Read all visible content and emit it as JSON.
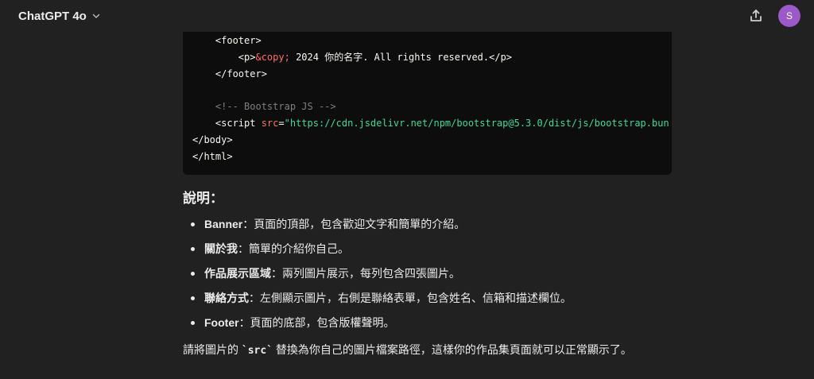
{
  "header": {
    "model_name": "ChatGPT 4o",
    "avatar_initial": "S"
  },
  "code": {
    "lines": [
      [
        {
          "t": "    "
        },
        {
          "c": "punc",
          "t": "<footer>"
        }
      ],
      [
        {
          "t": "        "
        },
        {
          "c": "punc",
          "t": "<p>"
        },
        {
          "c": "ent",
          "t": "&copy;"
        },
        {
          "c": "punc",
          "t": " 2024 你的名字. All rights reserved.</p>"
        }
      ],
      [
        {
          "t": "    "
        },
        {
          "c": "punc",
          "t": "</footer>"
        }
      ],
      [
        {
          "t": ""
        }
      ],
      [
        {
          "t": "    "
        },
        {
          "c": "cmt",
          "t": "<!-- Bootstrap JS -->"
        }
      ],
      [
        {
          "t": "    "
        },
        {
          "c": "punc",
          "t": "<script "
        },
        {
          "c": "attr",
          "t": "src"
        },
        {
          "c": "punc",
          "t": "="
        },
        {
          "c": "str",
          "t": "\"https://cdn.jsdelivr.net/npm/bootstrap@5.3.0/dist/js/bootstrap.bun"
        }
      ],
      [
        {
          "c": "punc",
          "t": "</body>"
        }
      ],
      [
        {
          "c": "punc",
          "t": "</html>"
        }
      ]
    ]
  },
  "explanation": {
    "heading": "說明：",
    "items": [
      {
        "term": "Banner",
        "desc": "：頁面的頂部，包含歡迎文字和簡單的介紹。"
      },
      {
        "term": "關於我",
        "desc": "：簡單的介紹你自己。"
      },
      {
        "term": "作品展示區域",
        "desc": "：兩列圖片展示，每列包含四張圖片。"
      },
      {
        "term": "聯絡方式",
        "desc": "：左側顯示圖片，右側是聯絡表單，包含姓名、信箱和描述欄位。"
      },
      {
        "term": "Footer",
        "desc": "：頁面的底部，包含版權聲明。"
      }
    ],
    "closing_before": "請將圖片的 ",
    "closing_code": "`src`",
    "closing_after": " 替換為你自己的圖片檔案路徑，這樣你的作品集頁面就可以正常顯示了。"
  },
  "icons": {
    "model_chevron": "chevron-down-icon",
    "share": "share-icon"
  },
  "colors": {
    "avatar_bg": "#9c59c9",
    "string": "#3fd99c",
    "attribute": "#ff6b6b"
  }
}
